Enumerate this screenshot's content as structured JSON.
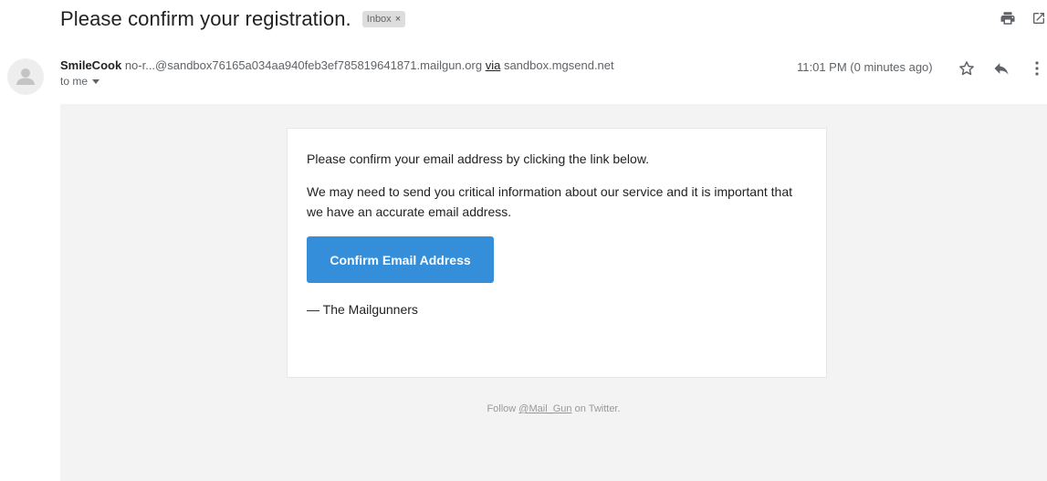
{
  "email": {
    "subject": "Please confirm your registration.",
    "label": "Inbox",
    "label_remove": "×"
  },
  "sender": {
    "name": "SmileCook",
    "address": "no-r...@sandbox76165a034aa940feb3ef785819641871.mailgun.org",
    "via_label": "via",
    "via_domain": "sandbox.mgsend.net",
    "recipient": "to me",
    "timestamp": "11:01 PM (0 minutes ago)"
  },
  "body": {
    "intro": "Please confirm your email address by clicking the link below.",
    "explanation": "We may need to send you critical information about our service and it is important that we have an accurate email address.",
    "button_label": "Confirm Email Address",
    "signoff": "— The Mailgunners"
  },
  "footer": {
    "prefix": "Follow",
    "handle": "@Mail_Gun",
    "suffix": "on Twitter."
  },
  "icons": {
    "print": "print-icon",
    "open_new_window": "open-in-new-window-icon",
    "avatar": "avatar-icon",
    "star": "star-icon",
    "reply": "reply-icon",
    "more": "more-vertical-icon",
    "dropdown": "caret-down-icon"
  },
  "colors": {
    "button": "#348eda",
    "canvas": "#f3f3f3",
    "label_chip": "#dddddd"
  }
}
